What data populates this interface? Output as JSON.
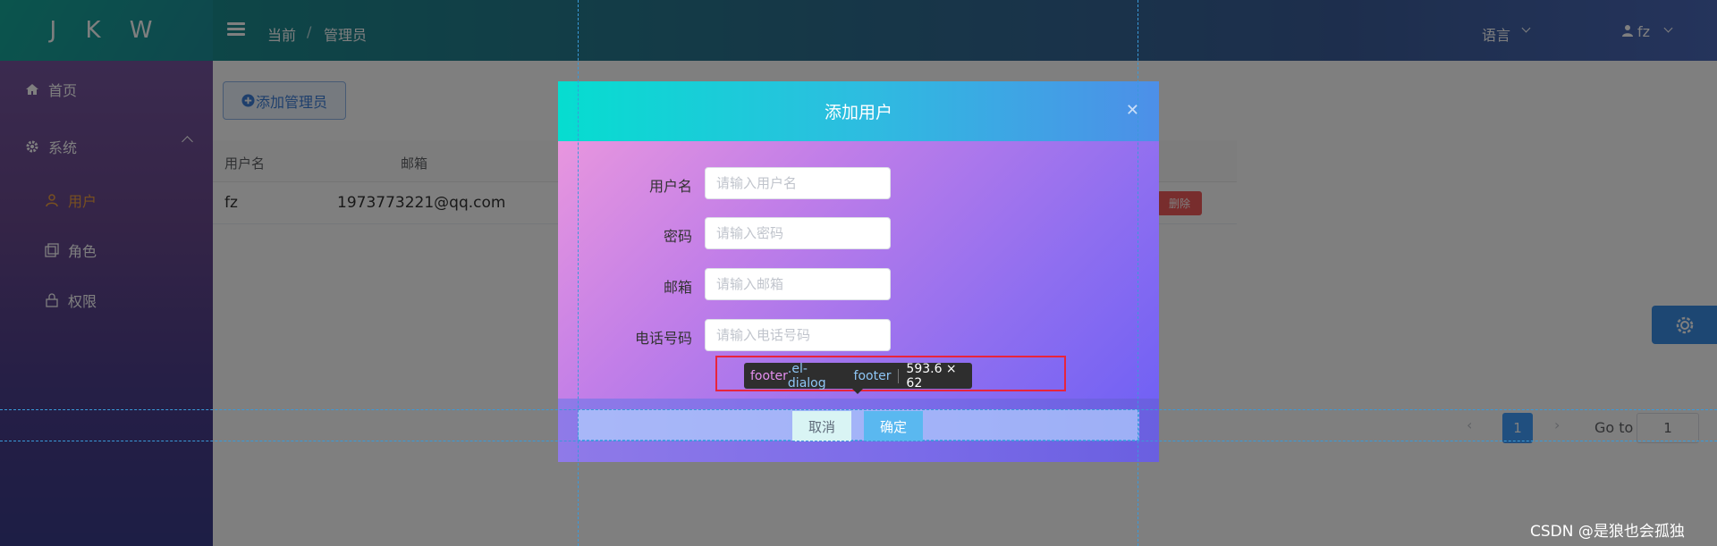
{
  "sidebar": {
    "logo": "J K W",
    "items": [
      {
        "label": "首页",
        "icon": "home-icon"
      },
      {
        "label": "系统",
        "icon": "gear-icon"
      },
      {
        "label": "用户",
        "icon": "user-icon",
        "active": true
      },
      {
        "label": "角色",
        "icon": "copy-icon"
      },
      {
        "label": "权限",
        "icon": "lock-icon"
      }
    ]
  },
  "header": {
    "breadcrumb": [
      "当前",
      "管理员"
    ],
    "separator": "/",
    "language": "语言",
    "user": "fz"
  },
  "main": {
    "add_button": "添加管理员",
    "columns": [
      "用户名",
      "邮箱"
    ],
    "rows": [
      {
        "username": "fz",
        "email": "1973773221@qq.com",
        "delete_label": "删除"
      }
    ]
  },
  "dialog": {
    "title": "添加用户",
    "fields": [
      {
        "label": "用户名",
        "placeholder": "请输入用户名"
      },
      {
        "label": "密码",
        "placeholder": "请输入密码"
      },
      {
        "label": "邮箱",
        "placeholder": "请输入邮箱"
      },
      {
        "label": "电话号码",
        "placeholder": "请输入电话号码"
      }
    ],
    "cancel": "取消",
    "confirm": "确定"
  },
  "pagination": {
    "current": "1",
    "goto_label": "Go to",
    "goto_value": "1"
  },
  "devtools_tooltip": {
    "tag": "footer",
    "class1": ".el-dialog",
    "class2": "footer",
    "size": "593.6 × 62"
  },
  "watermark": "CSDN @是狼也会孤独",
  "colors": {
    "accent": "#409eff",
    "danger": "#f05b5b",
    "highlight_red": "#e8243c"
  }
}
